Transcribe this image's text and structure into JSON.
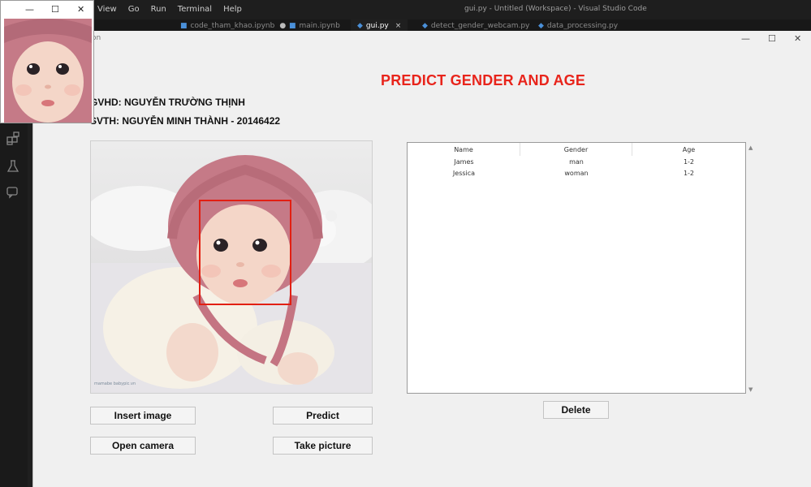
{
  "vscode": {
    "menu": [
      "View",
      "Go",
      "Run",
      "Terminal",
      "Help"
    ],
    "title": "gui.py - Untitled (Workspace) - Visual Studio Code",
    "tabs": [
      {
        "label": "code_tham_khao.ipynb",
        "modified": "●"
      },
      {
        "label": "main.ipynb"
      },
      {
        "label": "gui.py",
        "close": "×"
      },
      {
        "label": "detect_gender_webcam.py"
      },
      {
        "label": "data_processing.py"
      }
    ]
  },
  "preview_window": {
    "minimize": "—",
    "maximize": "☐",
    "close": "✕"
  },
  "app": {
    "title_fragment": "on",
    "window_controls": {
      "minimize": "—",
      "maximize": "☐",
      "close": "✕"
    },
    "heading": "PREDICT GENDER AND AGE",
    "supervisor": "GVHD: NGUYỄN TRƯỜNG THỊNH",
    "student": "SVTH: NGUYỄN MINH THÀNH  -  20146422",
    "watermark": "mamabe\nbabypic.vn",
    "buttons": {
      "insert_image": "Insert image",
      "predict": "Predict",
      "open_camera": "Open camera",
      "take_picture": "Take picture",
      "delete": "Delete"
    },
    "table": {
      "columns": [
        "Name",
        "Gender",
        "Age"
      ],
      "rows": [
        [
          "James",
          "man",
          "1-2"
        ],
        [
          "Jessica",
          "woman",
          "1-2"
        ]
      ]
    }
  },
  "colors": {
    "heading": "#e8241b",
    "face_box": "#e21f12"
  }
}
